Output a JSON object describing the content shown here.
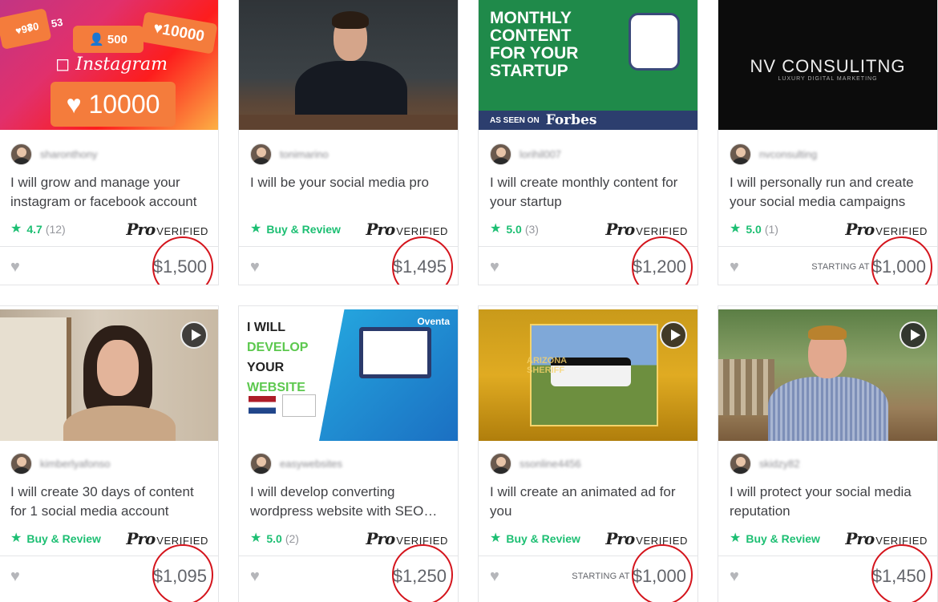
{
  "ui": {
    "star_glyph": "★",
    "heart_glyph": "♥",
    "pro_label": "Pro",
    "verified_label": "VERIFIED",
    "buy_review_label": "Buy & Review",
    "starting_at_label": "STARTING AT"
  },
  "cards": [
    {
      "seller": "sharonthony",
      "title": "I will grow and manage your instagram or facebook account",
      "rating": "4.7",
      "rating_count": "(12)",
      "price": "$1,500",
      "thumb_text": {
        "b1": "97",
        "b2": "80",
        "b3": "53",
        "b4": "500",
        "b5": "10000",
        "logo": "Instagram",
        "big": "10000"
      }
    },
    {
      "seller": "tonimarino",
      "title": "I will be your social media pro",
      "price": "$1,495"
    },
    {
      "seller": "lorihil007",
      "title": "I will create monthly content for your startup",
      "rating": "5.0",
      "rating_count": "(3)",
      "price": "$1,200",
      "thumb_text": {
        "headline1": "MONTHLY",
        "headline2": "CONTENT",
        "headline3": "FOR YOUR",
        "headline4": "STARTUP",
        "as_seen": "AS SEEN ON",
        "forbes": "Forbes"
      }
    },
    {
      "seller": "nvconsulting",
      "title": "I will personally run and create your social media campaigns",
      "rating": "5.0",
      "rating_count": "(1)",
      "price": "$1,000",
      "thumb_text": {
        "brand": "NV CONSULITNG",
        "sub": "LUXURY DIGITAL MARKETING"
      }
    },
    {
      "seller": "kimberlyafonso",
      "title": "I will create 30 days of content for 1 social media account",
      "price": "$1,095"
    },
    {
      "seller": "easywebsites",
      "title": "I will develop converting wordpress website with SEO…",
      "rating": "5.0",
      "rating_count": "(2)",
      "price": "$1,250",
      "thumb_text": {
        "l1": "I WILL",
        "l2": "DEVELOP",
        "l3": "YOUR",
        "l4": "WEBSITE",
        "brand": "Oventa"
      }
    },
    {
      "seller": "ssonline4456",
      "title": "I will create an animated ad for you",
      "price": "$1,000",
      "thumb_text": {
        "arizona": "ARIZONA",
        "sheriff": "SHERIFF"
      }
    },
    {
      "seller": "skidzy82",
      "title": "I will protect your social media reputation",
      "price": "$1,450"
    }
  ]
}
